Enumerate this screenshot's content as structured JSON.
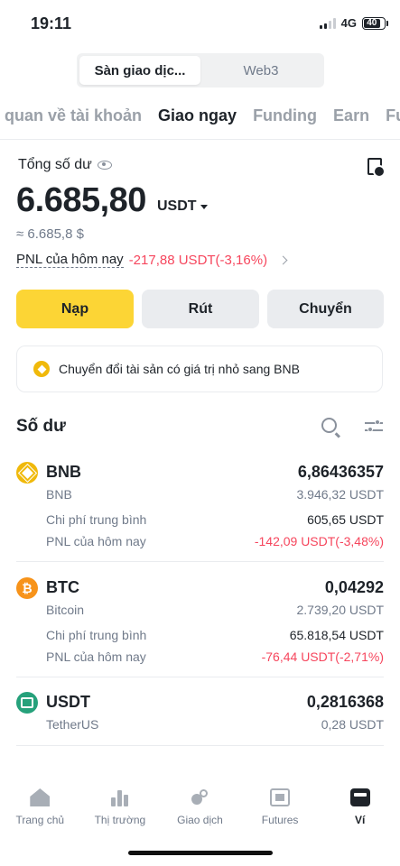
{
  "status_bar": {
    "time": "19:11",
    "network": "4G",
    "battery": "40"
  },
  "segment": {
    "exchange": "Sàn giao dịc...",
    "web3": "Web3"
  },
  "tabs": [
    "‹ quan về tài khoản",
    "Giao ngay",
    "Funding",
    "Earn",
    "Fu"
  ],
  "balance": {
    "label": "Tổng số dư",
    "amount": "6.685,80",
    "unit": "USDT",
    "approx": "≈ 6.685,8 $",
    "pnl_label": "PNL của hôm nay",
    "pnl_value": "-217,88 USDT(-3,16%)"
  },
  "actions": {
    "deposit": "Nạp",
    "withdraw": "Rút",
    "transfer": "Chuyển"
  },
  "convert_banner": "Chuyển đổi tài sản có giá trị nhỏ sang BNB",
  "assets_title": "Số dư",
  "assets": [
    {
      "symbol": "BNB",
      "name": "BNB",
      "amount": "6,86436357",
      "usd": "3.946,32 USDT",
      "avg_label": "Chi phí trung bình",
      "avg_value": "605,65 USDT",
      "pnl_label": "PNL của hôm nay",
      "pnl_value": "-142,09 USDT(-3,48%)"
    },
    {
      "symbol": "BTC",
      "name": "Bitcoin",
      "amount": "0,04292",
      "usd": "2.739,20 USDT",
      "icon_glyph": "₿",
      "avg_label": "Chi phí trung bình",
      "avg_value": "65.818,54 USDT",
      "pnl_label": "PNL của hôm nay",
      "pnl_value": "-76,44 USDT(-2,71%)"
    },
    {
      "symbol": "USDT",
      "name": "TetherUS",
      "amount": "0,2816368",
      "usd": "0,28 USDT"
    }
  ],
  "bottom_nav": [
    "Trang chủ",
    "Thị trường",
    "Giao dịch",
    "Futures",
    "Ví"
  ],
  "colors": {
    "accent": "#fcd535",
    "negative": "#f6465d",
    "text": "#1e2329",
    "muted": "#707a8a"
  }
}
